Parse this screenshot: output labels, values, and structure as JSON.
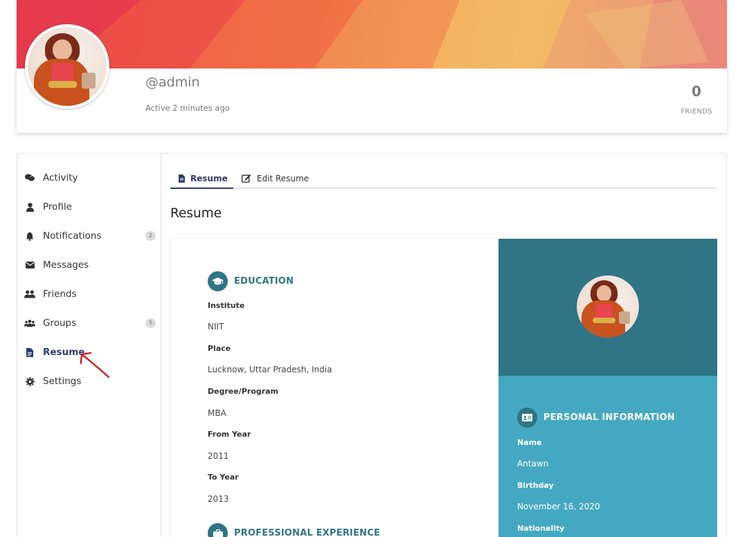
{
  "header": {
    "username": "@admin",
    "active_status": "Active 2 minutes ago",
    "friends_count": "0",
    "friends_label": "FRIENDS"
  },
  "sidebar": {
    "items": [
      {
        "label": "Activity",
        "icon": "comments-icon"
      },
      {
        "label": "Profile",
        "icon": "user-icon"
      },
      {
        "label": "Notifications",
        "icon": "bell-icon",
        "badge": "2"
      },
      {
        "label": "Messages",
        "icon": "envelope-icon"
      },
      {
        "label": "Friends",
        "icon": "users-icon"
      },
      {
        "label": "Groups",
        "icon": "group-icon",
        "badge": "5"
      },
      {
        "label": "Resume",
        "icon": "document-icon",
        "active": true
      },
      {
        "label": "Settings",
        "icon": "gear-icon"
      }
    ]
  },
  "tabs": [
    {
      "label": "Resume",
      "icon": "document-icon",
      "active": true
    },
    {
      "label": "Edit Resume",
      "icon": "edit-icon"
    }
  ],
  "page_title": "Resume",
  "education": {
    "title": "EDUCATION",
    "fields": [
      {
        "label": "Institute",
        "value": "NIIT"
      },
      {
        "label": "Place",
        "value": "Lucknow, Uttar Pradesh, India"
      },
      {
        "label": "Degree/Program",
        "value": "MBA"
      },
      {
        "label": "From Year",
        "value": "2011"
      },
      {
        "label": "To Year",
        "value": "2013"
      }
    ]
  },
  "experience": {
    "title": "PROFESSIONAL EXPERIENCE"
  },
  "personal": {
    "title": "PERSONAL INFORMATION",
    "fields": [
      {
        "label": "Name",
        "value": "Antawn"
      },
      {
        "label": "Birthday",
        "value": "November 16, 2020"
      },
      {
        "label": "Nationality",
        "value": ""
      }
    ]
  },
  "colors": {
    "accent_navy": "#2f3b6e",
    "teal_dark": "#2f7585",
    "teal_light": "#45a8c2",
    "annotation_red": "#d0191f"
  }
}
